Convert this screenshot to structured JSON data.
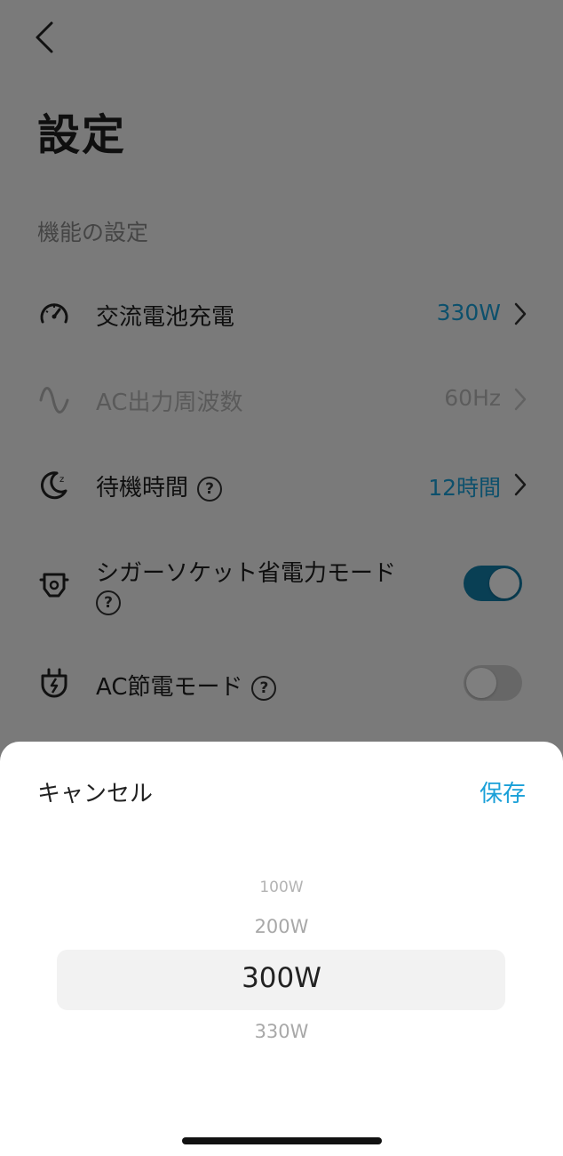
{
  "header": {
    "title": "設定",
    "back_icon": "chevron-left-icon"
  },
  "section": {
    "label": "機能の設定"
  },
  "rows": [
    {
      "icon": "speedometer-icon",
      "label": "交流電池充電",
      "value": "330W",
      "value_color": "#1aa0d8",
      "enabled": true
    },
    {
      "icon": "sine-wave-icon",
      "label": "AC出力周波数",
      "value": "60Hz",
      "value_color": "#b8b8b8",
      "enabled": false
    },
    {
      "icon": "moon-icon",
      "label": "待機時間",
      "value": "12時間",
      "value_color": "#1aa0d8",
      "has_help": true,
      "enabled": true
    },
    {
      "icon": "car-socket-icon",
      "label": "シガーソケット省電力モード",
      "has_help": true,
      "toggle_on": true
    },
    {
      "icon": "ac-plug-icon",
      "label": "AC節電モード",
      "has_help": true,
      "toggle_on": false
    }
  ],
  "help_symbol": "?",
  "sheet": {
    "cancel_label": "キャンセル",
    "save_label": "保存",
    "options": [
      "100W",
      "200W",
      "300W",
      "330W"
    ],
    "selected": "300W"
  },
  "colors": {
    "accent": "#1aa0d8",
    "toggle_on": "#137ea9",
    "toggle_off": "#cfcfcf"
  }
}
